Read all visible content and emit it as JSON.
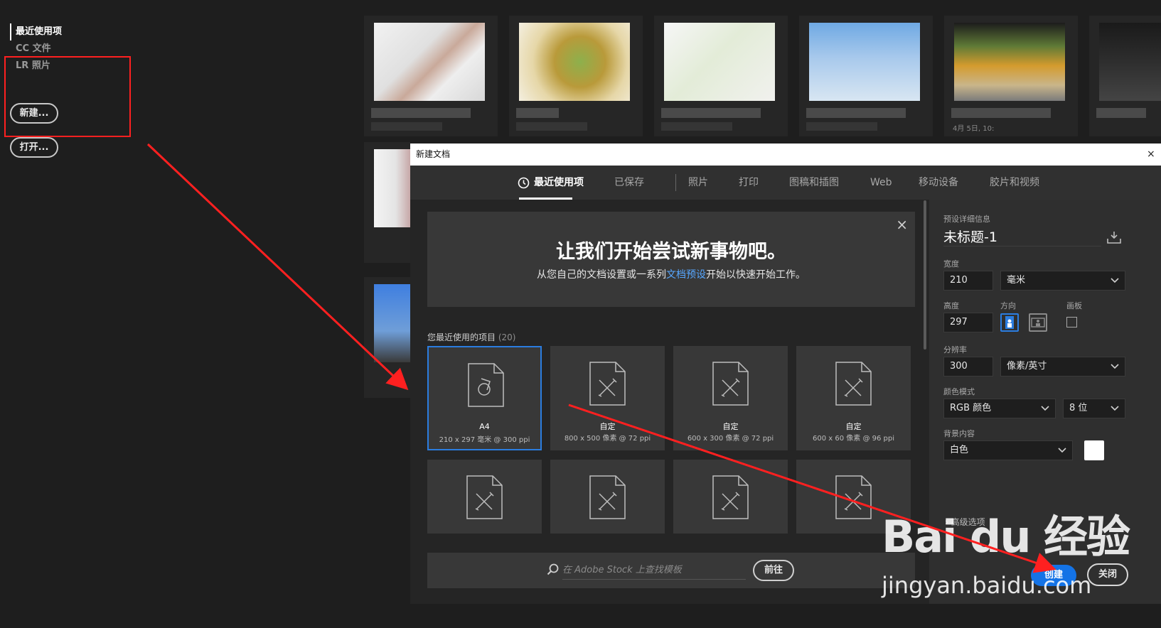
{
  "home": {
    "nav": [
      "最近使用项",
      "CC 文件",
      "LR 照片"
    ],
    "new_button": "新建...",
    "open_button": "打开..."
  },
  "thumbnail_date": "4月 5日, 10:",
  "dialog": {
    "title": "新建文档",
    "close_x": "×",
    "tabs": [
      "最近使用项",
      "已保存",
      "照片",
      "打印",
      "图稿和插图",
      "Web",
      "移动设备",
      "胶片和视频"
    ],
    "welcome": {
      "close": "×",
      "title": "让我们开始尝试新事物吧。",
      "sub_before": "从您自己的文档设置或一系列",
      "sub_link": "文档预设",
      "sub_after": "开始以快速开始工作。"
    },
    "recent_heading": "您最近使用的项目",
    "recent_count": "(20)",
    "presets": [
      {
        "name": "A4",
        "spec": "210 x 297 毫米 @ 300 ppi"
      },
      {
        "name": "自定",
        "spec": "800 x 500 像素 @ 72 ppi"
      },
      {
        "name": "自定",
        "spec": "600 x 300 像素 @ 72 ppi"
      },
      {
        "name": "自定",
        "spec": "600 x 60 像素 @ 96 ppi"
      }
    ],
    "stock_placeholder": "在 Adobe Stock 上查找模板",
    "goto_button": "前往"
  },
  "panel": {
    "section_title": "预设详细信息",
    "doc_name": "未标题-1",
    "width_label": "宽度",
    "width_value": "210",
    "width_unit": "毫米",
    "height_label": "高度",
    "height_value": "297",
    "orientation_label": "方向",
    "artboard_label": "画板",
    "resolution_label": "分辨率",
    "resolution_value": "300",
    "resolution_unit": "像素/英寸",
    "color_mode_label": "颜色模式",
    "color_mode": "RGB 颜色",
    "bit_depth": "8 位",
    "background_label": "背景内容",
    "background_value": "白色",
    "advanced": "高级选项",
    "create_button": "创建",
    "close_button": "关闭"
  },
  "watermark": {
    "logo": "Bai du 经验",
    "url": "jingyan.baidu.com"
  },
  "colors": {
    "accent": "#1473e6",
    "annotation": "#ff2020",
    "link": "#57a7ff"
  }
}
